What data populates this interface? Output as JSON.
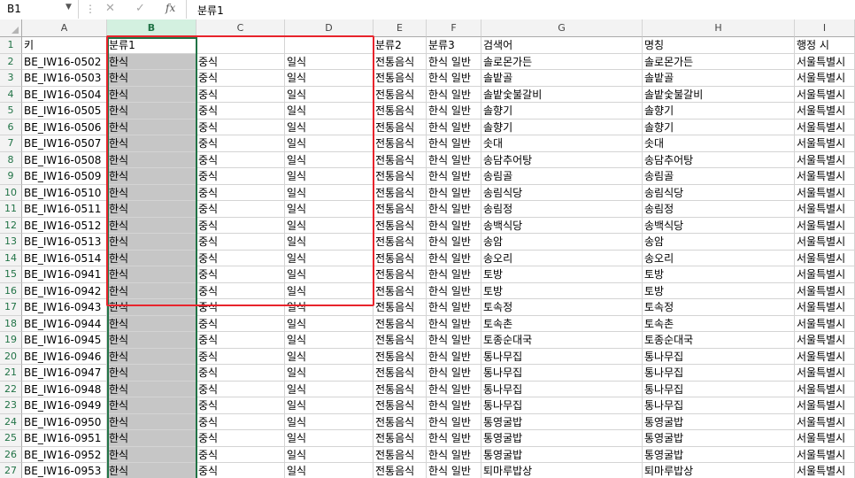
{
  "name_box": "B1",
  "formula_value": "분류1",
  "formula_buttons": {
    "cancel": "✕",
    "enter": "✓",
    "fx": "fx"
  },
  "columns": [
    "A",
    "B",
    "C",
    "D",
    "E",
    "F",
    "G",
    "H",
    "I"
  ],
  "header_row": {
    "row": "1",
    "A": "키",
    "B": "분류1",
    "C": "",
    "D": "",
    "E": "분류2",
    "F": "분류3",
    "G": "검색어",
    "H": "명칭",
    "I": "행정 시"
  },
  "rows": [
    {
      "row": "2",
      "A": "BE_IW16-0502",
      "G": "솔로몬가든",
      "H": "솔로몬가든"
    },
    {
      "row": "3",
      "A": "BE_IW16-0503",
      "G": "솔밭골",
      "H": "솔밭골"
    },
    {
      "row": "4",
      "A": "BE_IW16-0504",
      "G": "솔밭숯불갈비",
      "H": "솔밭숯불갈비"
    },
    {
      "row": "5",
      "A": "BE_IW16-0505",
      "G": "솔향기",
      "H": "솔향기"
    },
    {
      "row": "6",
      "A": "BE_IW16-0506",
      "G": "솔향기",
      "H": "솔향기"
    },
    {
      "row": "7",
      "A": "BE_IW16-0507",
      "G": "솟대",
      "H": "솟대"
    },
    {
      "row": "8",
      "A": "BE_IW16-0508",
      "G": "송담추어탕",
      "H": "송담추어탕"
    },
    {
      "row": "9",
      "A": "BE_IW16-0509",
      "G": "송림골",
      "H": "송림골"
    },
    {
      "row": "10",
      "A": "BE_IW16-0510",
      "G": "송림식당",
      "H": "송림식당"
    },
    {
      "row": "11",
      "A": "BE_IW16-0511",
      "G": "송림정",
      "H": "송림정"
    },
    {
      "row": "12",
      "A": "BE_IW16-0512",
      "G": "송백식당",
      "H": "송백식당"
    },
    {
      "row": "13",
      "A": "BE_IW16-0513",
      "G": "송암",
      "H": "송암"
    },
    {
      "row": "14",
      "A": "BE_IW16-0514",
      "G": "송오리",
      "H": "송오리"
    },
    {
      "row": "15",
      "A": "BE_IW16-0941",
      "G": "토방",
      "H": "토방"
    },
    {
      "row": "16",
      "A": "BE_IW16-0942",
      "G": "토방",
      "H": "토방"
    },
    {
      "row": "17",
      "A": "BE_IW16-0943",
      "G": "토속정",
      "H": "토속정"
    },
    {
      "row": "18",
      "A": "BE_IW16-0944",
      "G": "토속촌",
      "H": "토속촌"
    },
    {
      "row": "19",
      "A": "BE_IW16-0945",
      "G": "토종순대국",
      "H": "토종순대국"
    },
    {
      "row": "20",
      "A": "BE_IW16-0946",
      "G": "통나무집",
      "H": "통나무집"
    },
    {
      "row": "21",
      "A": "BE_IW16-0947",
      "G": "통나무집",
      "H": "통나무집"
    },
    {
      "row": "22",
      "A": "BE_IW16-0948",
      "G": "통나무집",
      "H": "통나무집"
    },
    {
      "row": "23",
      "A": "BE_IW16-0949",
      "G": "통나무집",
      "H": "통나무집"
    },
    {
      "row": "24",
      "A": "BE_IW16-0950",
      "G": "통영굴밥",
      "H": "통영굴밥"
    },
    {
      "row": "25",
      "A": "BE_IW16-0951",
      "G": "통영굴밥",
      "H": "통영굴밥"
    },
    {
      "row": "26",
      "A": "BE_IW16-0952",
      "G": "통영굴밥",
      "H": "통영굴밥"
    },
    {
      "row": "27",
      "A": "BE_IW16-0953",
      "G": "퇴마루밥상",
      "H": "퇴마루밥상"
    }
  ],
  "repeated_values": {
    "B": "한식",
    "C": "중식",
    "D": "일식",
    "E": "전통음식",
    "F": "한식 일반",
    "I": "서울특별시"
  },
  "colors": {
    "selection_green": "#217346",
    "highlight_red": "#e8242c",
    "selected_fill": "#c6c6c6"
  }
}
